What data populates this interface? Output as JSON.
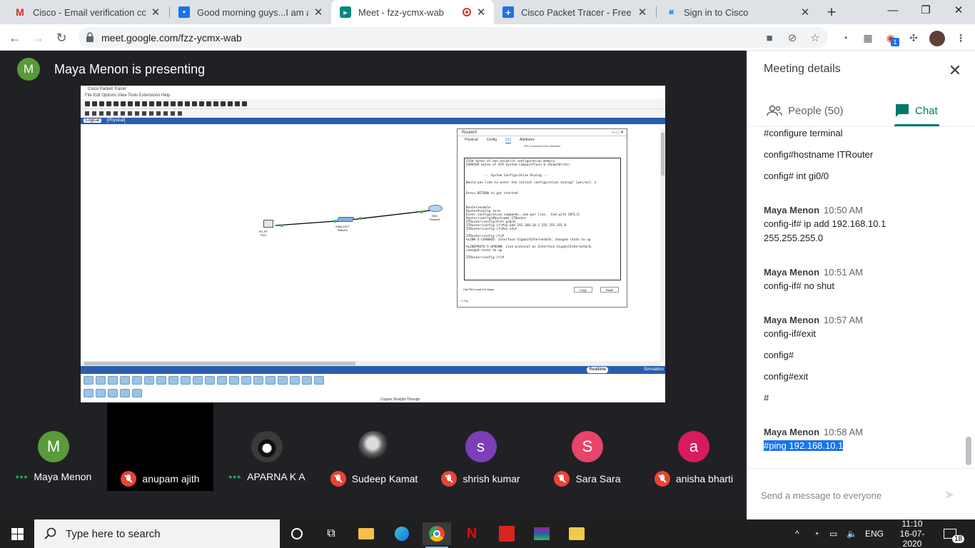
{
  "browser": {
    "tabs": [
      {
        "title": "Cisco - Email verification code",
        "favicon": "gmail-icon",
        "color": "#d93025"
      },
      {
        "title": "Good morning guys...I am atta",
        "favicon": "classroom-icon",
        "color": "#1a73e8"
      },
      {
        "title": "Meet - fzz-ycmx-wab",
        "favicon": "meet-icon",
        "color": "#00897b"
      },
      {
        "title": "Cisco Packet Tracer - Free - do",
        "favicon": "cisco-plus-icon",
        "color": "#1a73e8"
      },
      {
        "title": "Sign in to Cisco",
        "favicon": "cisco-icon",
        "color": "#049fd9"
      }
    ],
    "url": "meet.google.com/fzz-ycmx-wab",
    "extension_badge": "1"
  },
  "meet": {
    "presenter_initial": "M",
    "presenter_text": "Maya Menon is presenting",
    "participants": [
      {
        "name": "Maya Menon",
        "initial": "M",
        "color": "#5a9a3a",
        "muted": false
      },
      {
        "name": "anupam ajith",
        "initial": "",
        "color": "#000000",
        "muted": true
      },
      {
        "name": "APARNA K A",
        "initial": "",
        "color": "#2a2a2a",
        "muted": false
      },
      {
        "name": "Sudeep Kamat",
        "initial": "",
        "color": "#888888",
        "muted": true
      },
      {
        "name": "shrish kumar",
        "initial": "s",
        "color": "#7b3fb8",
        "muted": true
      },
      {
        "name": "Sara Sara",
        "initial": "S",
        "color": "#e8446c",
        "muted": true
      },
      {
        "name": "anisha bharti",
        "initial": "a",
        "color": "#d81b60",
        "muted": true
      }
    ]
  },
  "packet_tracer": {
    "window_title": "Cisco Packet Tracer",
    "menu": "File  Edit  Options  View  Tools  Extensions  Help",
    "logical_tab": "Logical",
    "physical_tab": "[Physical]",
    "realtime": "Realtime",
    "simulation": "Simulation",
    "cable_label": "Copper Straight-Through",
    "devices": {
      "pc": "PC-PT\nPC0",
      "switch": "2960-24TT\nSwitch0",
      "router": "2901\nRouter0"
    },
    "router_window": {
      "title": "Router0",
      "tabs": [
        "Physical",
        "Config",
        "CLI",
        "Attributes"
      ],
      "heading": "IOS Command Line Interface",
      "cli": "255K bytes of non-volatile configuration memory.\n249856K bytes of ATA System CompactFlash 0 (Read/Write)\n\n\n         --- System Configuration Dialog ---\n\nWould you like to enter the initial configuration dialog? [yes/no]: n\n\n\nPress RETURN to get started!\n\n\n\nRouter>enable\nRouter#config term\nEnter configuration commands, one per line.  End with CNTL/Z.\nRouter(config)#hostname ITRouter\nITRouter(config)#int gi0/0\nITRouter(config-if)#ip add 192.168.10.1 255.255.255.0\nITRouter(config-if)#no shut\n\nITRouter(config-if)#\n%LINK-5-CHANGED: Interface GigabitEthernet0/0, changed state to up\n\n%LINEPROTO-5-UPDOWN: Line protocol on Interface GigabitEthernet0/0,\nchanged state to up\n\nITRouter(config-if)#",
      "copy": "Copy",
      "paste": "Paste",
      "hint": "Ctrl+F6 to exit CLI focus",
      "top": "Top"
    }
  },
  "panel": {
    "title": "Meeting details",
    "people_tab": "People (50)",
    "chat_tab": "Chat",
    "messages": [
      {
        "sender": "",
        "time": "",
        "lines": [
          "#configure terminal"
        ]
      },
      {
        "sender": "",
        "time": "",
        "lines": [
          "config#hostname ITRouter"
        ]
      },
      {
        "sender": "",
        "time": "",
        "lines": [
          "config# int gi0/0"
        ]
      },
      {
        "sender": "Maya Menon",
        "time": "10:50 AM",
        "lines": [
          "config-if# ip add 192.168.10.1",
          "255.255.255.0"
        ]
      },
      {
        "sender": "Maya Menon",
        "time": "10:51 AM",
        "lines": [
          "config-if# no shut"
        ]
      },
      {
        "sender": "Maya Menon",
        "time": "10:57 AM",
        "lines": [
          "config-if#exit"
        ]
      },
      {
        "sender": "",
        "time": "",
        "lines": [
          "config#"
        ]
      },
      {
        "sender": "",
        "time": "",
        "lines": [
          "config#exit"
        ]
      },
      {
        "sender": "",
        "time": "",
        "lines": [
          "#"
        ]
      },
      {
        "sender": "Maya Menon",
        "time": "10:58 AM",
        "lines": [
          "#ping 192.168.10.1"
        ]
      }
    ],
    "compose_placeholder": "Send a message to everyone"
  },
  "taskbar": {
    "search_placeholder": "Type here to search",
    "lang": "ENG",
    "time": "11:10",
    "date": "16-07-2020",
    "notifications": "18"
  }
}
